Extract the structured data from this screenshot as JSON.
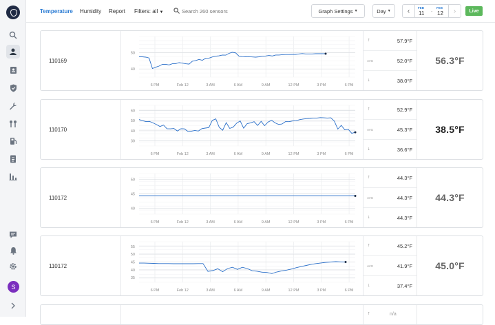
{
  "sidebar": {
    "icons": [
      "search-icon",
      "sensor-icon",
      "badge-icon",
      "shield-icon",
      "wrench-icon",
      "route-icon",
      "fuel-icon",
      "document-icon",
      "reports-icon",
      "chat-icon",
      "bell-icon",
      "gear-icon",
      "chevron-right-icon"
    ],
    "avatar_letter": "S",
    "avatar_color": "#7b2fbe"
  },
  "topbar": {
    "tabs": [
      "Temperature",
      "Humidity",
      "Report"
    ],
    "filters": "Filters: all",
    "search_placeholder": "Search 260 sensors",
    "graph_settings": "Graph Settings",
    "range": "Day",
    "from_month": "FEB",
    "from_day": "11",
    "to_month": "FEB",
    "to_day": "12",
    "live": "Live",
    "accent": "#2a7bd3",
    "live_color": "#5cb85c"
  },
  "x_ticks": [
    "6 PM",
    "Feb 12",
    "3 AM",
    "6 AM",
    "9 AM",
    "12 PM",
    "3 PM",
    "6 PM"
  ],
  "cards": [
    {
      "name": "110169",
      "max": "57.9°F",
      "avg": "52.0°F",
      "min": "38.0°F",
      "current": "56.3°F",
      "chart_data": {
        "type": "line",
        "yticks": [
          40,
          50
        ],
        "ylim": [
          35,
          60
        ],
        "y": [
          47.5,
          47.5,
          47.3,
          46.8,
          40.3,
          41.1,
          41.8,
          42.9,
          42.9,
          42.5,
          43.2,
          43.3,
          43.9,
          43.6,
          43.2,
          43.0,
          44.8,
          45.2,
          45.9,
          45.4,
          46.6,
          46.7,
          47.4,
          47.9,
          48.1,
          48.6,
          48.5,
          49.6,
          50.3,
          49.9,
          47.9,
          47.6,
          47.5,
          47.6,
          47.4,
          47.3,
          47.5,
          47.9,
          48.0,
          48.3,
          48.0,
          48.6,
          48.6,
          48.8,
          48.9,
          48.9,
          49.0,
          49.0,
          49.3,
          49.5,
          49.3,
          49.3,
          49.3,
          49.4,
          49.4,
          49.4,
          49.4
        ],
        "end_marker": true
      }
    },
    {
      "name": "110170",
      "max": "52.9°F",
      "avg": "45.3°F",
      "min": "36.6°F",
      "current": "38.5°F",
      "chart_data": {
        "type": "line",
        "yticks": [
          30,
          40,
          50,
          60
        ],
        "ylim": [
          25,
          65
        ],
        "y": [
          51.0,
          49.9,
          49.0,
          49.2,
          47.7,
          46.1,
          44.2,
          45.6,
          42.0,
          41.9,
          42.2,
          39.7,
          42.0,
          41.9,
          39.4,
          39.6,
          40.3,
          39.7,
          42.1,
          42.6,
          43.1,
          50.2,
          51.7,
          43.3,
          40.5,
          48.0,
          42.3,
          43.6,
          47.5,
          49.6,
          42.5,
          47.0,
          47.8,
          48.9,
          45.2,
          49.3,
          44.9,
          48.6,
          50.3,
          47.8,
          46.2,
          46.6,
          49.0,
          48.9,
          49.6,
          49.8,
          50.9,
          51.5,
          51.9,
          52.1,
          52.5,
          52.5,
          52.9,
          52.7,
          52.5,
          52.7,
          49.5,
          41.6,
          45.3,
          40.9,
          41.4,
          37.5,
          38.5
        ],
        "end_marker": true
      }
    },
    {
      "name": "110172",
      "max": "44.3°F",
      "avg": "44.3°F",
      "min": "44.3°F",
      "current": "44.3°F",
      "chart_data": {
        "type": "line",
        "yticks": [
          40,
          45,
          50
        ],
        "ylim": [
          38,
          52
        ],
        "y": [
          44.3,
          44.3
        ],
        "end_marker": true
      }
    },
    {
      "name": "110172",
      "max": "45.2°F",
      "avg": "41.9°F",
      "min": "37.4°F",
      "current": "45.0°F",
      "chart_data": {
        "type": "line",
        "yticks": [
          35,
          40,
          45,
          50,
          55
        ],
        "ylim": [
          32,
          58
        ],
        "y": [
          44.3,
          44.3,
          44.2,
          44.1,
          44.0,
          44.0,
          44.0,
          43.9,
          43.9,
          43.9,
          43.9,
          43.9,
          44.0,
          44.0,
          39.0,
          39.5,
          40.7,
          38.8,
          40.8,
          41.6,
          40.3,
          41.6,
          40.8,
          39.4,
          39.1,
          38.5,
          38.3,
          37.6,
          38.6,
          39.3,
          39.8,
          40.5,
          41.4,
          42.1,
          42.8,
          43.5,
          44.0,
          44.4,
          44.8,
          45.0,
          45.2,
          45.1,
          45.0
        ],
        "end_marker": true
      }
    }
  ],
  "partial_card": {
    "avg": "n/a"
  }
}
